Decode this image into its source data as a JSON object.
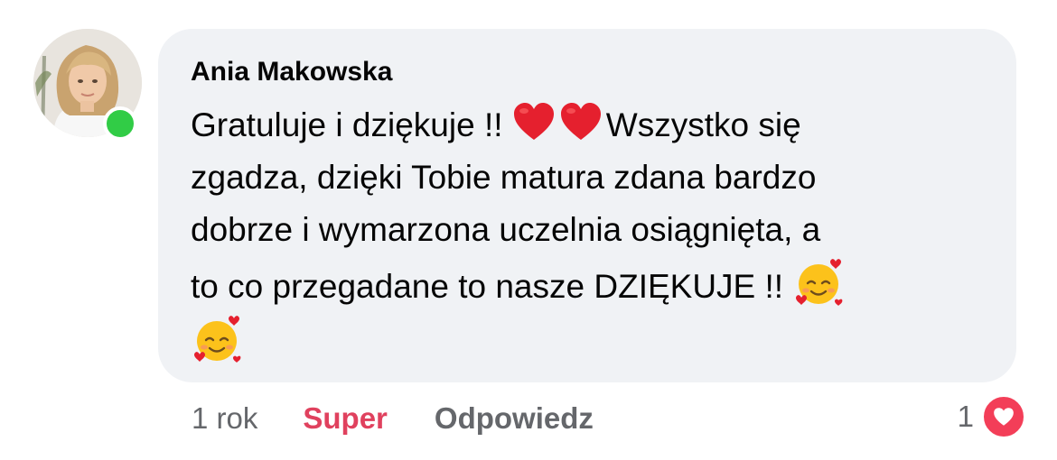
{
  "comment": {
    "author": "Ania Makowska",
    "online": true,
    "text_line1_before": "Gratuluje i dziękuje !! ",
    "text_line1_after": "Wszystko się",
    "text_line2": "zgadza, dzięki Tobie matura zdana bardzo",
    "text_line3": "dobrze i wymarzona uczelnia osiągnięta, a",
    "text_line4": "to co przegadane to nasze DZIĘKUJE !! ",
    "inline_emojis": [
      "red-heart",
      "red-heart",
      "smiling-face-with-hearts",
      "smiling-face-with-hearts"
    ]
  },
  "meta": {
    "time": "1 rok",
    "reaction_label": "Super",
    "reply_label": "Odpowiedz"
  },
  "reactions": {
    "count": "1",
    "icon": "heart-reaction-icon"
  },
  "colors": {
    "bubble": "#f0f2f5",
    "online": "#31cc46",
    "super": "#e0415e",
    "muted": "#65676b",
    "reaction": "#f33e58"
  }
}
